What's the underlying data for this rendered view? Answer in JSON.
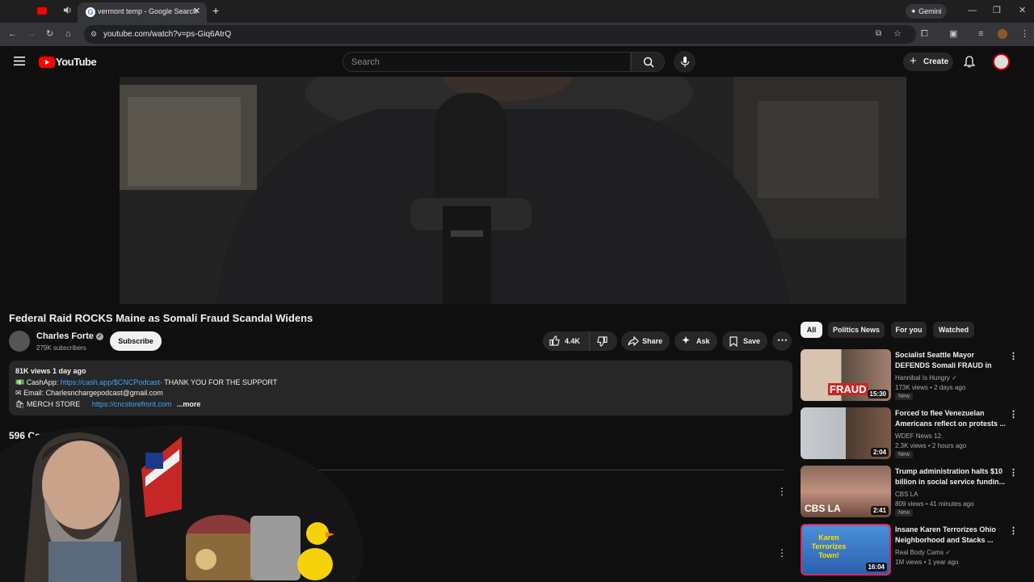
{
  "browser": {
    "tab_title": "vermont temp - Google Search",
    "tab_close": "✕",
    "new_tab": "+",
    "url": "youtube.com/watch?v=ps-Giq6AtrQ",
    "gemini_label": "Gemini"
  },
  "header": {
    "logo_text": "YouTube",
    "search_placeholder": "Search",
    "create_label": "Create"
  },
  "video": {
    "title": "Federal Raid ROCKS Maine as Somali Fraud Scandal Widens",
    "channel_name": "Charles Forte",
    "subscribers": "279K subscribers",
    "subscribe_label": "Subscribe",
    "likes": "4.4K",
    "share_label": "Share",
    "ask_label": "Ask",
    "save_label": "Save"
  },
  "description": {
    "stats": "81K views  1 day ago",
    "cashapp_label": "CashApp: ",
    "cashapp_link": "https://cash.app/$CNCPodcast-",
    "cashapp_thanks": " THANK YOU FOR THE SUPPORT",
    "email_line": "Email: Charlesnchargepodcast@gmail.com",
    "merch_label": "MERCH STORE",
    "merch_link": "https://cncstorefront.com",
    "more_label": "...more"
  },
  "comments": {
    "count_label": "596 Com"
  },
  "chips": [
    "All",
    "Politics News",
    "For you",
    "Watched"
  ],
  "recommendations": [
    {
      "title": "Socialist Seattle Mayor DEFENDS Somali FRAUD in He...",
      "channel": "Hannibal Is Hungry",
      "meta": "173K views • 2 days ago",
      "badge": "New",
      "duration": "15:30",
      "thumb_text": "FRAUD"
    },
    {
      "title": "Forced to flee Venezuelan Americans reflect on protests ...",
      "channel": "WDEF News 12",
      "meta": "2.3K views • 2 hours ago",
      "badge": "New",
      "duration": "2:04",
      "thumb_text": ""
    },
    {
      "title": "Trump administration halts $10 billion in social service fundin...",
      "channel": "CBS LA",
      "meta": "809 views • 41 minutes ago",
      "badge": "New",
      "duration": "2:41",
      "thumb_text": "CBS LA"
    },
    {
      "title": "Insane Karen Terrorizes Ohio Neighborhood and Stacks ...",
      "channel": "Real Body Cams",
      "meta": "1M views • 1 year ago",
      "badge": "",
      "duration": "16:04",
      "thumb_text": "Karen Terrorizes Town!"
    }
  ],
  "colors": {
    "accent_red": "#ff0000",
    "link_blue": "#3ea6ff",
    "background": "#0f0f0f"
  }
}
